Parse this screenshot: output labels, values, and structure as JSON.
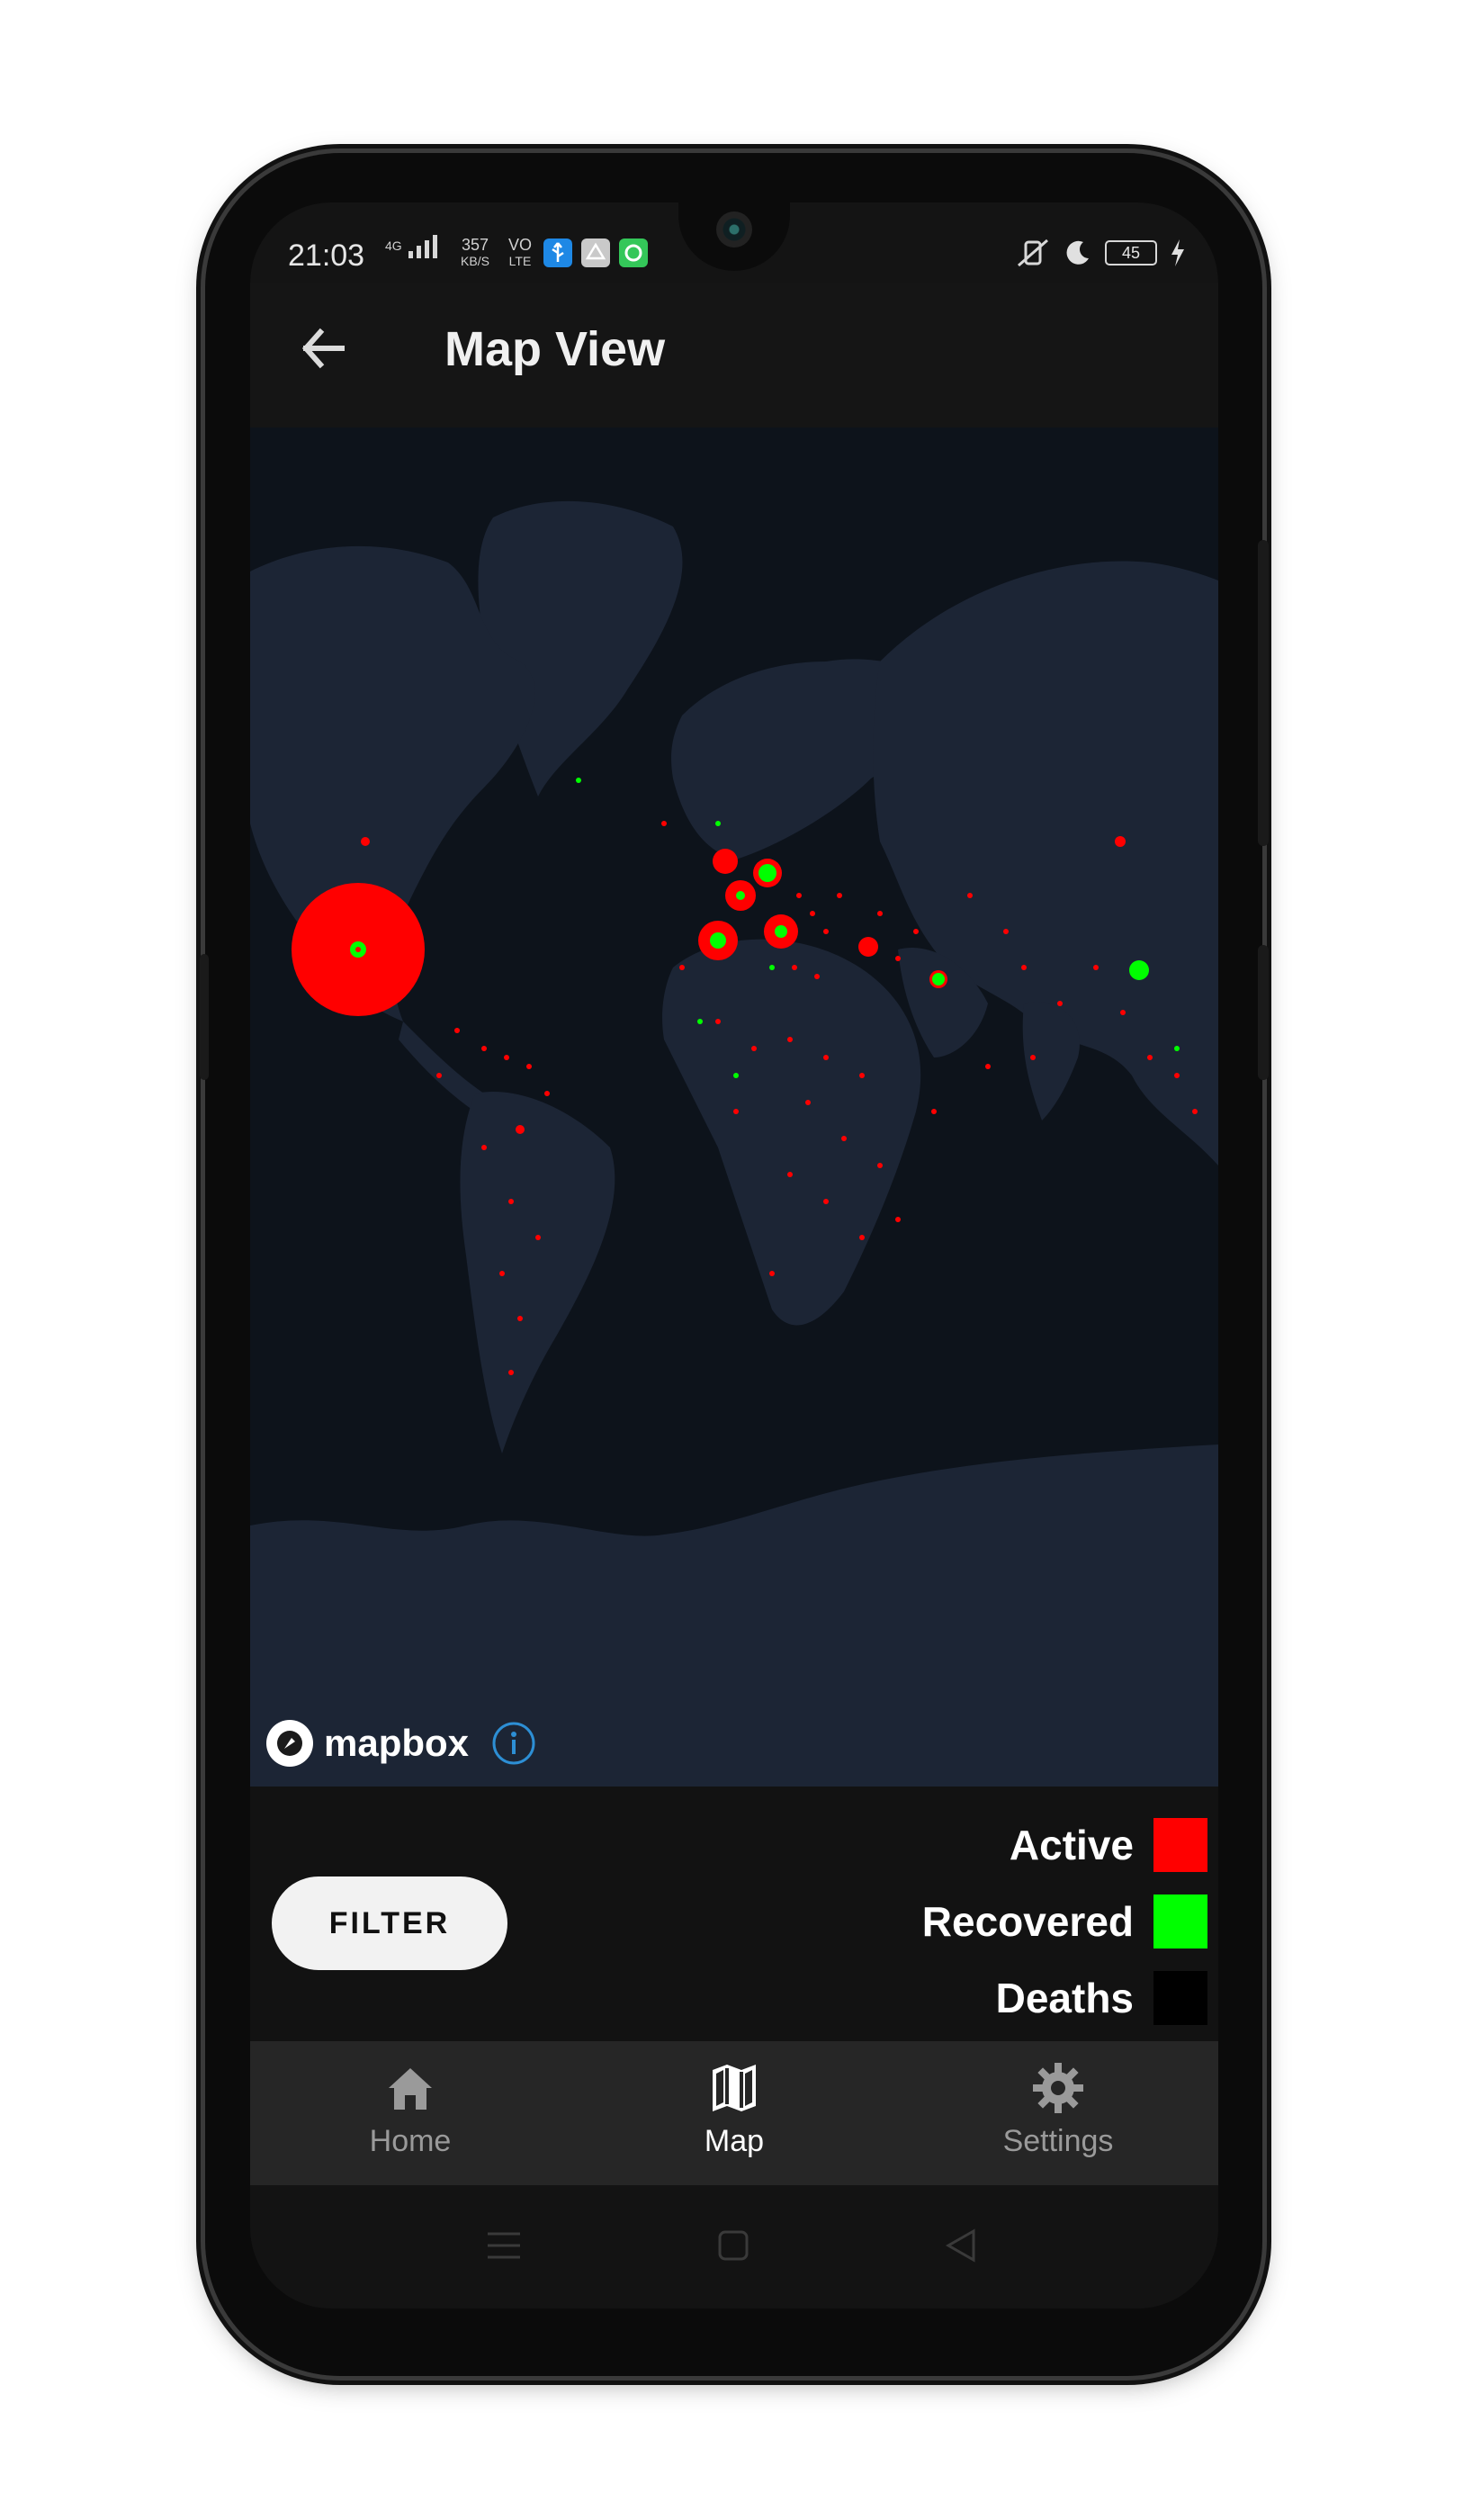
{
  "status_bar": {
    "time": "21:03",
    "network_speed": "357",
    "network_unit": "KB/S",
    "network_type": "VO",
    "network_lte": "LTE",
    "signal": "4G",
    "battery": "45"
  },
  "app_bar": {
    "title": "Map View",
    "back_icon": "arrow-left-icon"
  },
  "map": {
    "attribution": "mapbox",
    "info_icon": "info-icon",
    "active_color": "#ff0000",
    "recovered_color": "#00ff00",
    "land_color": "#1c2535",
    "water_color": "#0d131b"
  },
  "controls": {
    "filter_label": "FILTER"
  },
  "legend": {
    "items": [
      {
        "label": "Active",
        "color": "#ff0000"
      },
      {
        "label": "Recovered",
        "color": "#00ff00"
      },
      {
        "label": "Deaths",
        "color": "#000000"
      }
    ]
  },
  "bottom_nav": {
    "items": [
      {
        "label": "Home",
        "icon": "home-icon",
        "active": false
      },
      {
        "label": "Map",
        "icon": "map-icon",
        "active": true
      },
      {
        "label": "Settings",
        "icon": "gear-icon",
        "active": false
      }
    ]
  }
}
